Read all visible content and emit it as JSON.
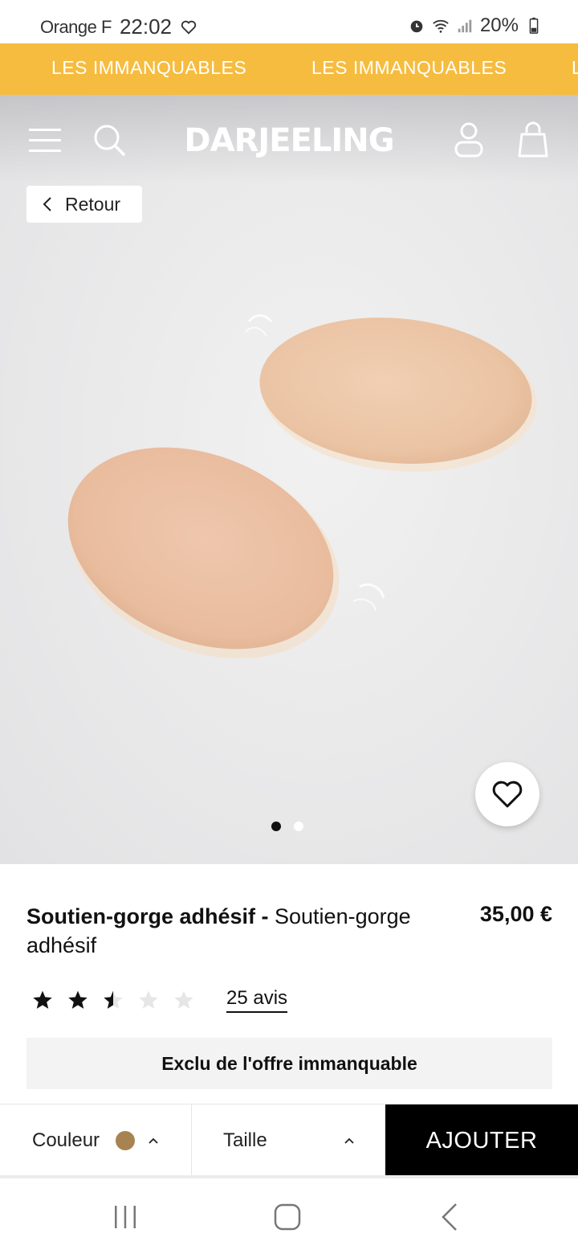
{
  "status_bar": {
    "carrier": "Orange F",
    "time": "22:02",
    "battery": "20%"
  },
  "banner": {
    "items": [
      "LES IMMANQUABLES",
      "LES IMMANQUABLES",
      "L"
    ]
  },
  "header": {
    "logo": "DARJEELING",
    "back_label": "Retour"
  },
  "gallery": {
    "image_count": 2,
    "active_index": 0
  },
  "product": {
    "name_bold": "Soutien-gorge adhésif -",
    "name_rest": " Soutien-gorge adhésif",
    "price": "35,00 €",
    "rating": 2.5,
    "rating_max": 5,
    "reviews_label": "25 avis",
    "promo_notice": "Exclu de l'offre immanquable"
  },
  "add_bar": {
    "color_label": "Couleur",
    "color_swatch": "#a88352",
    "size_label": "Taille",
    "add_label": "AJOUTER"
  },
  "colors": {
    "banner": "#f6bc3f",
    "button": "#000000"
  }
}
